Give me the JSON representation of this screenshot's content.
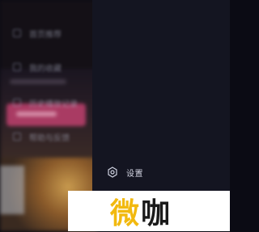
{
  "menu": {
    "items": [
      {
        "label": "首页推荐",
        "icon": "home-icon"
      },
      {
        "label": "我的收藏",
        "icon": "star-icon"
      },
      {
        "label": "历史播放记录",
        "icon": "history-icon"
      },
      {
        "label": "帮助与反馈",
        "icon": "help-icon"
      }
    ],
    "settings": {
      "label": "设置",
      "icon": "gear-icon"
    }
  },
  "watermark": {
    "part1": "微",
    "part2": "咖"
  },
  "colors": {
    "drawer_bg": "#141521",
    "accent_pink": "#c0416e",
    "watermark_yellow": "#f2b90f"
  }
}
